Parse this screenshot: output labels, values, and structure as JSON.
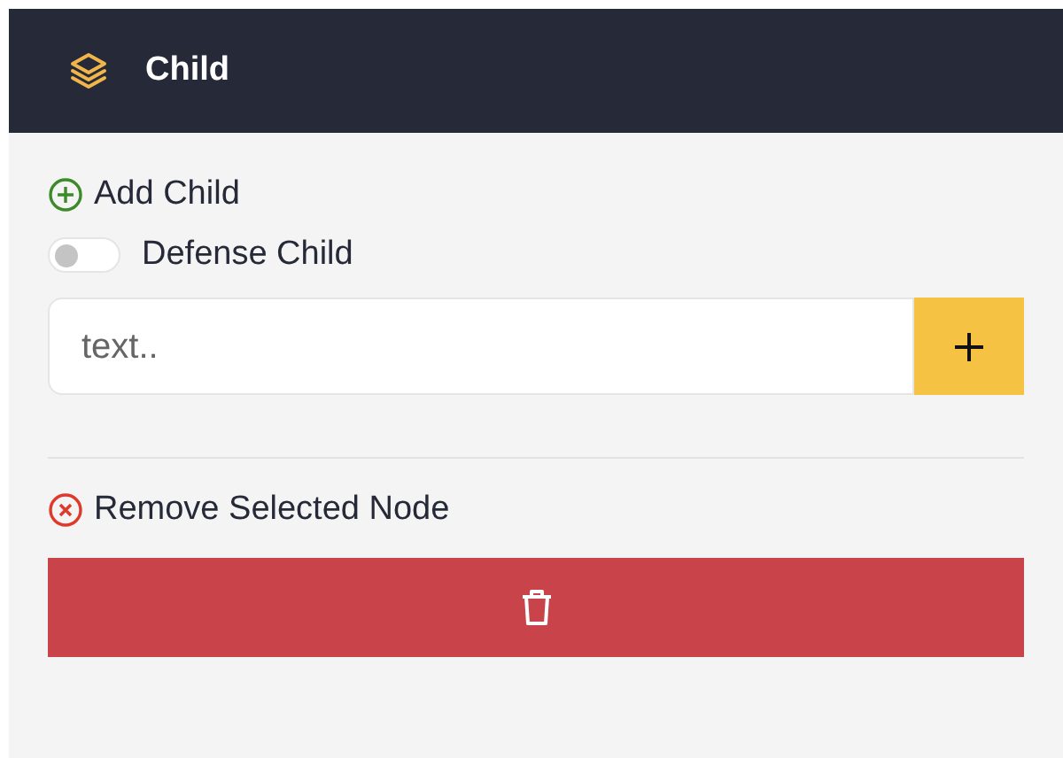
{
  "header": {
    "title": "Child"
  },
  "add_child": {
    "label": "Add Child"
  },
  "defense_toggle": {
    "label": "Defense Child",
    "on": false
  },
  "child_input": {
    "placeholder": "text.."
  },
  "remove": {
    "label": "Remove Selected Node"
  }
}
